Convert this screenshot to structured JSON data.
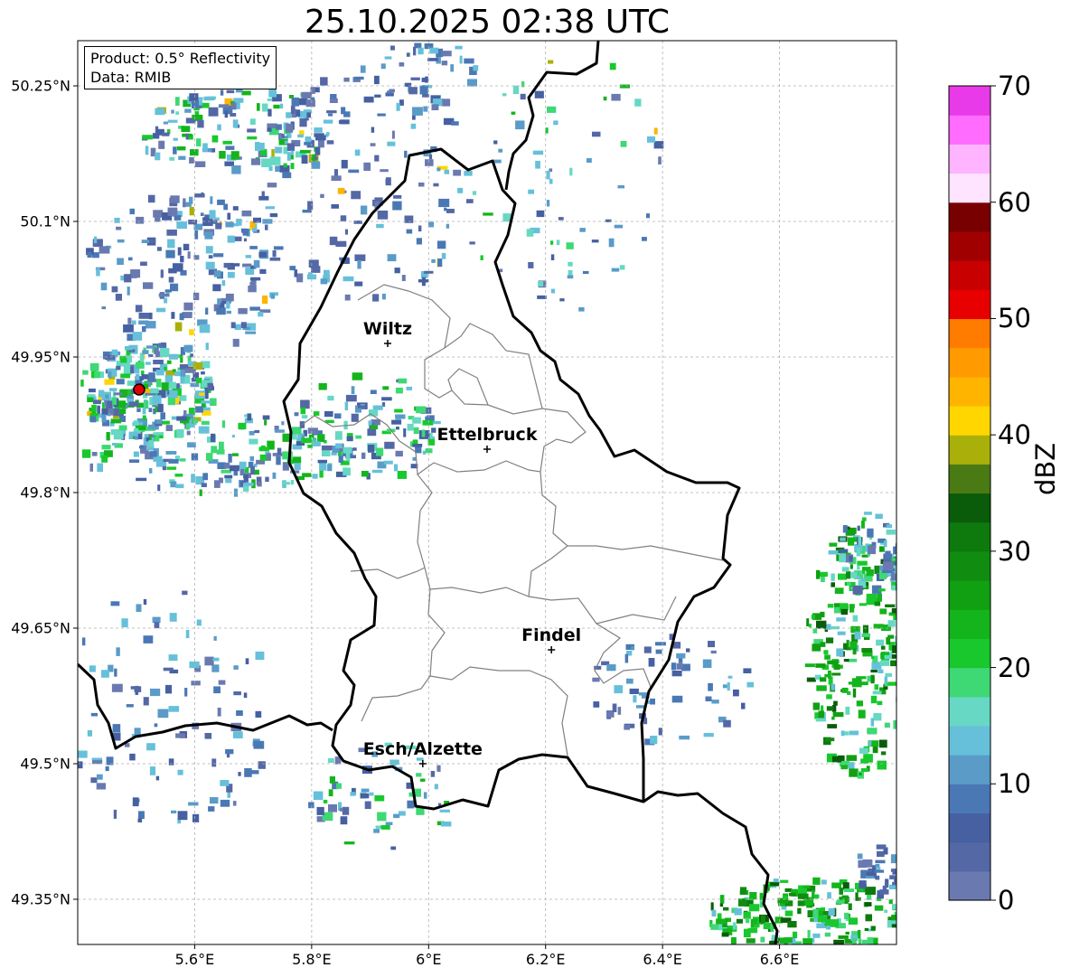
{
  "title": "25.10.2025 02:38 UTC",
  "info": {
    "product": "Product: 0.5° Reflectivity",
    "data_source": "Data: RMIB"
  },
  "axes": {
    "lon_ticks": [
      "5.6°E",
      "5.8°E",
      "6°E",
      "6.2°E",
      "6.4°E",
      "6.6°E"
    ],
    "lat_ticks": [
      "50.25°N",
      "50.1°N",
      "49.95°N",
      "49.8°N",
      "49.65°N",
      "49.5°N",
      "49.35°N"
    ],
    "lon_range": [
      5.4,
      6.8
    ],
    "lat_range": [
      49.3,
      50.3
    ]
  },
  "cities": [
    {
      "name": "Wiltz",
      "lon": 5.93,
      "lat": 49.965
    },
    {
      "name": "Ettelbruck",
      "lon": 6.1,
      "lat": 49.848
    },
    {
      "name": "Findel",
      "lon": 6.21,
      "lat": 49.626
    },
    {
      "name": "Esch/Alzette",
      "lon": 5.99,
      "lat": 49.5
    }
  ],
  "radar_site": {
    "lon": 5.505,
    "lat": 49.914,
    "color": "#e00000"
  },
  "colorbar": {
    "label": "dBZ",
    "ticks": [
      "0",
      "10",
      "20",
      "30",
      "40",
      "50",
      "60",
      "70"
    ],
    "min": 0,
    "max": 70,
    "step": 2.5,
    "colors": [
      "#6a7ab0",
      "#5468a6",
      "#4660a2",
      "#4a78b4",
      "#5a9bc8",
      "#66c0da",
      "#66d8c4",
      "#3ed874",
      "#18c82c",
      "#14b41c",
      "#10a012",
      "#108c10",
      "#0e7a0e",
      "#0a5c0a",
      "#4a7a14",
      "#aab00a",
      "#ffd600",
      "#ffb400",
      "#ff9a00",
      "#ff7c00",
      "#e80000",
      "#c80000",
      "#a00000",
      "#780000",
      "#ffe4ff",
      "#ffb4ff",
      "#ff6cff",
      "#e83ae8"
    ]
  },
  "styles": {
    "border_color": "#000000",
    "canton_color": "#808080",
    "grid_color": "#b0b0b0"
  }
}
